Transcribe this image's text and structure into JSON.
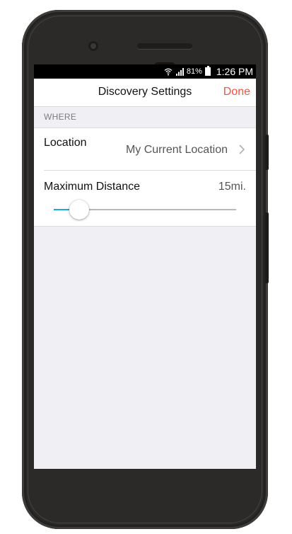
{
  "status_bar": {
    "battery": "81%",
    "time": "1:26 PM",
    "icons": [
      "wifi-icon",
      "signal-icon",
      "battery-icon"
    ]
  },
  "nav": {
    "title": "Discovery Settings",
    "done_label": "Done"
  },
  "section": {
    "header": "WHERE"
  },
  "location": {
    "label": "Location",
    "value": "My Current Location"
  },
  "distance": {
    "label": "Maximum Distance",
    "value": "15mi.",
    "slider_fraction": 0.14
  },
  "colors": {
    "accent": "#f4533c",
    "slider_fill": "#1ca8e3",
    "background": "#efeff4"
  }
}
